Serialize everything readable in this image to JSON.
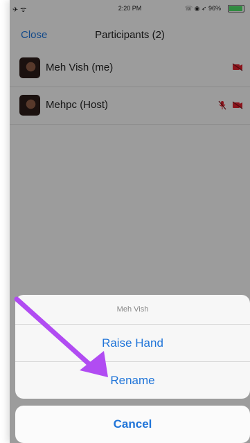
{
  "status": {
    "left_icons": "✈ ᯤ",
    "time": "2:20 PM",
    "right_icons": "☏ ◉ ➶",
    "battery": "96%"
  },
  "nav": {
    "close": "Close",
    "title": "Participants (2)"
  },
  "participants": [
    {
      "name": "Meh Vish (me)"
    },
    {
      "name": "Mehpc (Host)"
    }
  ],
  "sheet": {
    "title": "Meh Vish",
    "items": [
      "Raise Hand",
      "Rename"
    ],
    "cancel": "Cancel"
  },
  "colors": {
    "accent": "#1f74d8",
    "annotation_arrow": "#b14cf2",
    "muted_icon": "#d9202c"
  },
  "battery_level": 0.96
}
